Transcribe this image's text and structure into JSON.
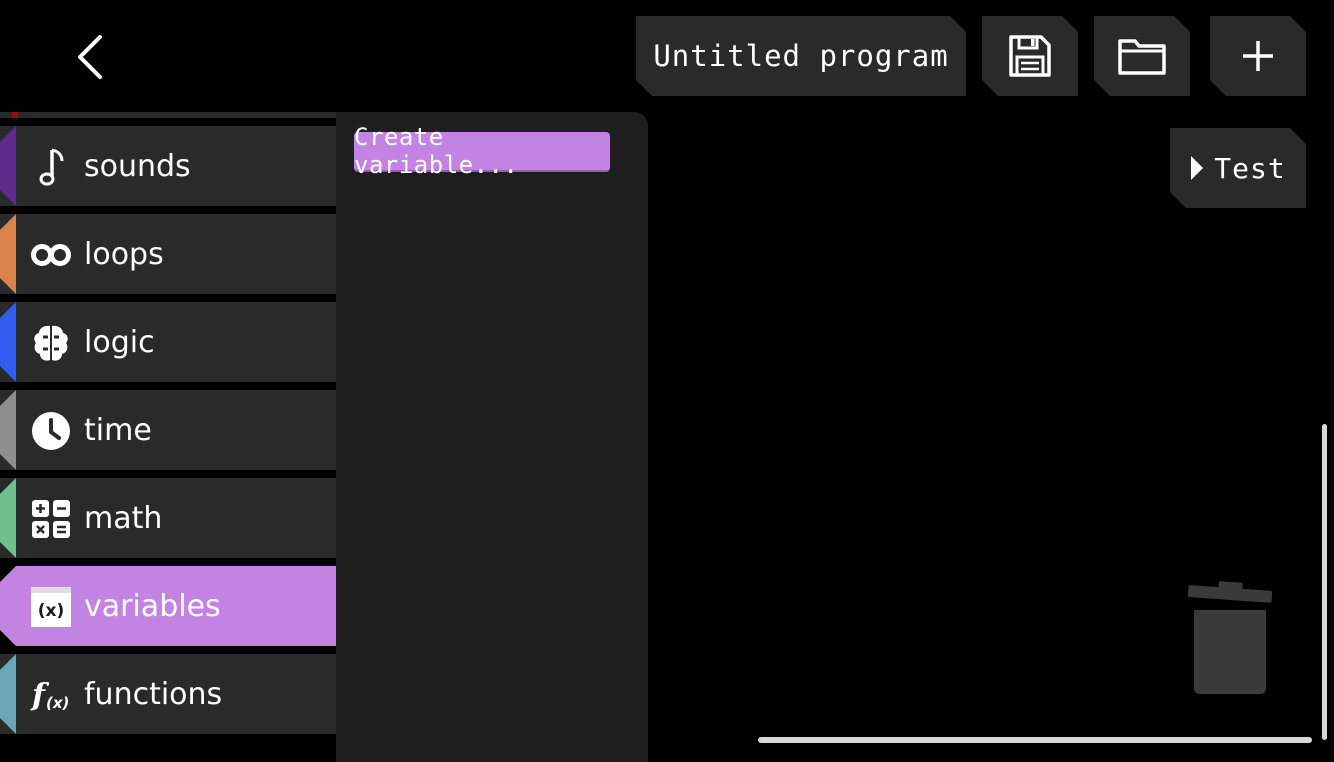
{
  "header": {
    "back_icon": "chevron-left-icon",
    "program_title": "Untitled program",
    "save_icon": "floppy-disk-icon",
    "open_icon": "folder-icon",
    "new_icon": "plus-icon"
  },
  "categories": [
    {
      "label": "sounds",
      "icon": "music-note-icon",
      "color": "#5b2a8a"
    },
    {
      "label": "loops",
      "icon": "infinity-loop-icon",
      "color": "#d9844a"
    },
    {
      "label": "logic",
      "icon": "brain-icon",
      "color": "#2f5ef0"
    },
    {
      "label": "time",
      "icon": "clock-icon",
      "color": "#8f8f8f"
    },
    {
      "label": "math",
      "icon": "calculator-icon",
      "color": "#6fbf8c"
    },
    {
      "label": "variables",
      "icon": "variable-x-icon",
      "color": "#c283e2",
      "selected": true
    },
    {
      "label": "functions",
      "icon": "function-fx-icon",
      "color": "#6aa8b8"
    }
  ],
  "flyout": {
    "create_variable_label": "Create variable..."
  },
  "workspace": {
    "test_label": "Test",
    "trash_icon": "trash-can-icon"
  },
  "colors": {
    "accent_variables": "#c283e2",
    "button_bg": "#2a2a2a",
    "flyout_bg": "#1e1e1e"
  }
}
